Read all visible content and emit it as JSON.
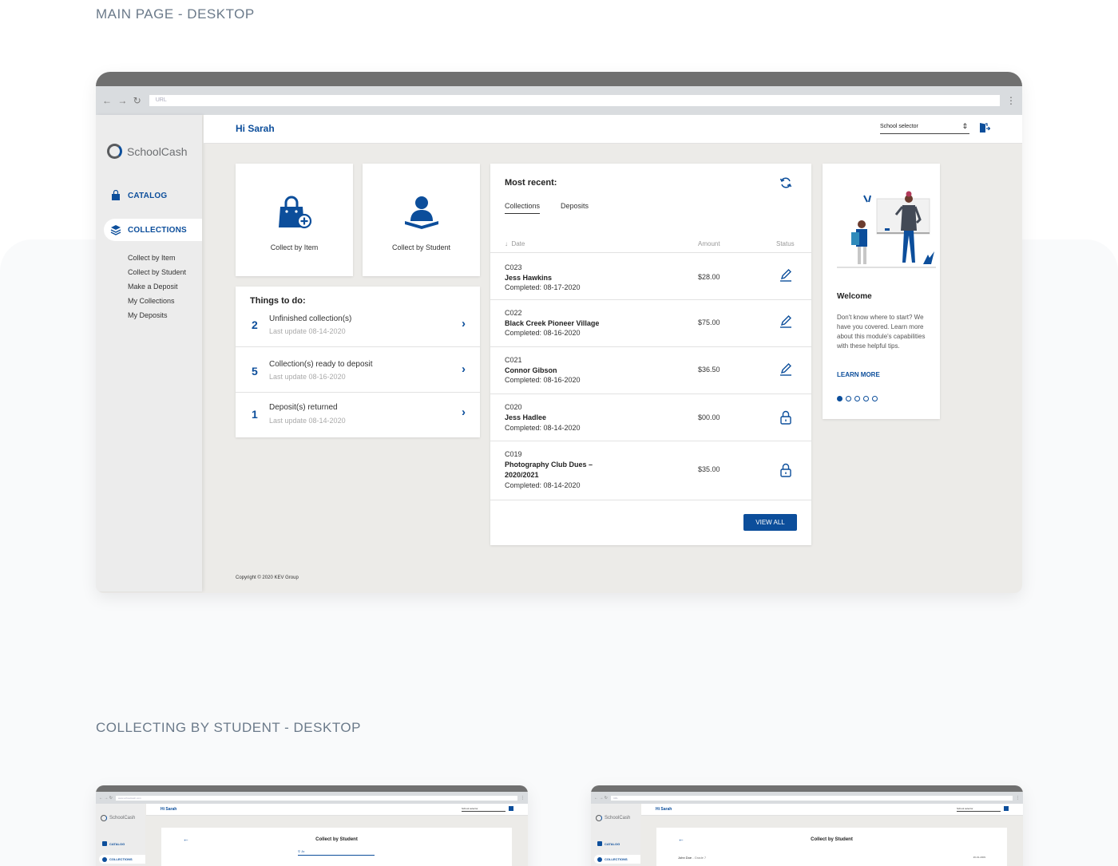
{
  "sections": {
    "main_title": "MAIN PAGE - DESKTOP",
    "student_title": "COLLECTING BY STUDENT - DESKTOP"
  },
  "browser": {
    "url_placeholder": "URL",
    "nav_symbols": "← → ↻",
    "menu_symbol": "⋮"
  },
  "app": {
    "logo_text": "SchoolCash",
    "greeting": "Hi Sarah",
    "school_selector": "School selector",
    "copyright": "Copyright © 2020 KEV Group"
  },
  "sidebar": {
    "catalog": "CATALOG",
    "collections": "COLLECTIONS",
    "sub_items": [
      "Collect by Item",
      "Collect by Student",
      "Make a Deposit",
      "My Collections",
      "My Deposits"
    ]
  },
  "quick_actions": {
    "collect_by_item": "Collect by Item",
    "collect_by_student": "Collect by Student"
  },
  "todo": {
    "title": "Things to do:",
    "items": [
      {
        "count": "2",
        "label": "Unfinished collection(s)",
        "sub": "Last update 08-14-2020"
      },
      {
        "count": "5",
        "label": "Collection(s) ready to deposit",
        "sub": "Last update 08-16-2020"
      },
      {
        "count": "1",
        "label": "Deposit(s) returned",
        "sub": "Last update 08-14-2020"
      }
    ]
  },
  "recent": {
    "title": "Most recent:",
    "tabs": [
      "Collections",
      "Deposits"
    ],
    "columns": {
      "date": "Date",
      "amount": "Amount",
      "status": "Status"
    },
    "rows": [
      {
        "code": "C023",
        "name": "Jess Hawkins",
        "completed": "Completed: 08-17-2020",
        "amount": "$28.00",
        "status": "edit"
      },
      {
        "code": "C022",
        "name": "Black Creek Pioneer Village",
        "completed": "Completed: 08-16-2020",
        "amount": "$75.00",
        "status": "edit"
      },
      {
        "code": "C021",
        "name": "Connor Gibson",
        "completed": "Completed: 08-16-2020",
        "amount": "$36.50",
        "status": "edit"
      },
      {
        "code": "C020",
        "name": "Jess Hadlee",
        "completed": "Completed: 08-14-2020",
        "amount": "$00.00",
        "status": "locked"
      },
      {
        "code": "C019",
        "name": "Photography Club Dues – 2020/2021",
        "completed": "Completed: 08-14-2020",
        "amount": "$35.00",
        "status": "locked"
      }
    ],
    "view_all": "VIEW ALL"
  },
  "welcome": {
    "title": "Welcome",
    "text": "Don't know where to start? We have you covered. Learn more about this module's capabilities with these helpful tips.",
    "link": "LEARN MORE",
    "carousel_total": 5,
    "carousel_active": 1
  },
  "small_screens": {
    "left": {
      "url": "www.schoolcash.com",
      "title": "Collect by Student",
      "search_value": "Jo"
    },
    "right": {
      "url": "URL",
      "title": "Collect by Student",
      "student_name": "John Doe",
      "student_grade": " - Grade 7",
      "date": "26-01-2009"
    }
  },
  "colors": {
    "brand": "#0c4e9b",
    "background": "#ecebe8",
    "sidebar": "#ececec"
  }
}
